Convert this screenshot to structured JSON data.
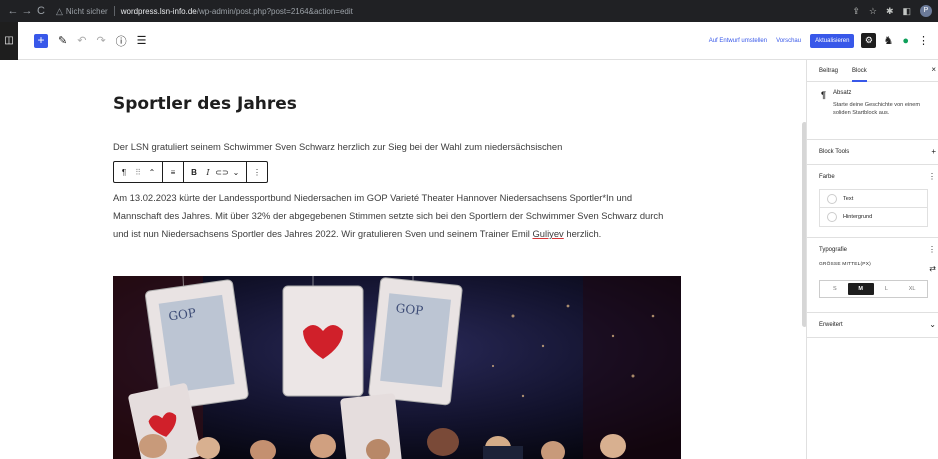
{
  "browser": {
    "back": "←",
    "forward": "→",
    "reload": "C",
    "warning_icon": "△",
    "security_label": "Nicht sicher",
    "url_host": "wordpress.lsn-info.de",
    "url_path": "/wp-admin/post.php?post=2164&action=edit",
    "profile_initial": "P"
  },
  "editor": {
    "add_block": "+",
    "switch_draft": "Auf Entwurf umstellen",
    "preview": "Vorschau",
    "update": "Aktualisieren"
  },
  "post": {
    "title": "Sportler des Jahres",
    "paragraph1": "Der LSN gratuliert seinem Schwimmer Sven Schwarz herzlich zur Sieg bei der Wahl zum niedersächsischen",
    "paragraph2_start": "Am 13.02.2023 kürte der Landessportbund Niedersachen im GOP Varieté Theater Hannover Niedersachsens Sportler*In und Mannschaft des Jahres. Mit über 32% der abgegebenen Stimmen setzte sich bei den Sportlern der Schwimmer Sven Schwarz durch und ist nun Niedersachsens Sportler des Jahres 2022. Wir gratulieren Sven und seinem Trainer Emil ",
    "paragraph2_name": "Guliyev",
    "paragraph2_end": " herzlich."
  },
  "block_toolbar": {
    "paragraph": "¶",
    "drag": "⠿",
    "move": "⌃",
    "align": "≡",
    "bold": "B",
    "italic": "I",
    "link": "⊂⊃",
    "more_rich": "⌄",
    "options": "⋮"
  },
  "sidebar": {
    "tab_post": "Beitrag",
    "tab_block": "Block",
    "close": "×",
    "block_name": "Absatz",
    "block_description": "Starte deine Geschichte von einem soliden Startblock aus.",
    "block_tools": "Block Tools",
    "color": "Farbe",
    "color_text": "Text",
    "color_background": "Hintergrund",
    "typography": "Typografie",
    "size_label": "GRÖSSE MITTEL(PX)",
    "sizes": [
      "S",
      "M",
      "L",
      "XL"
    ],
    "size_selected": "M",
    "advanced": "Erweitert"
  },
  "colors": {
    "accent": "#3858e9",
    "photo_background": "#0a0a18"
  }
}
